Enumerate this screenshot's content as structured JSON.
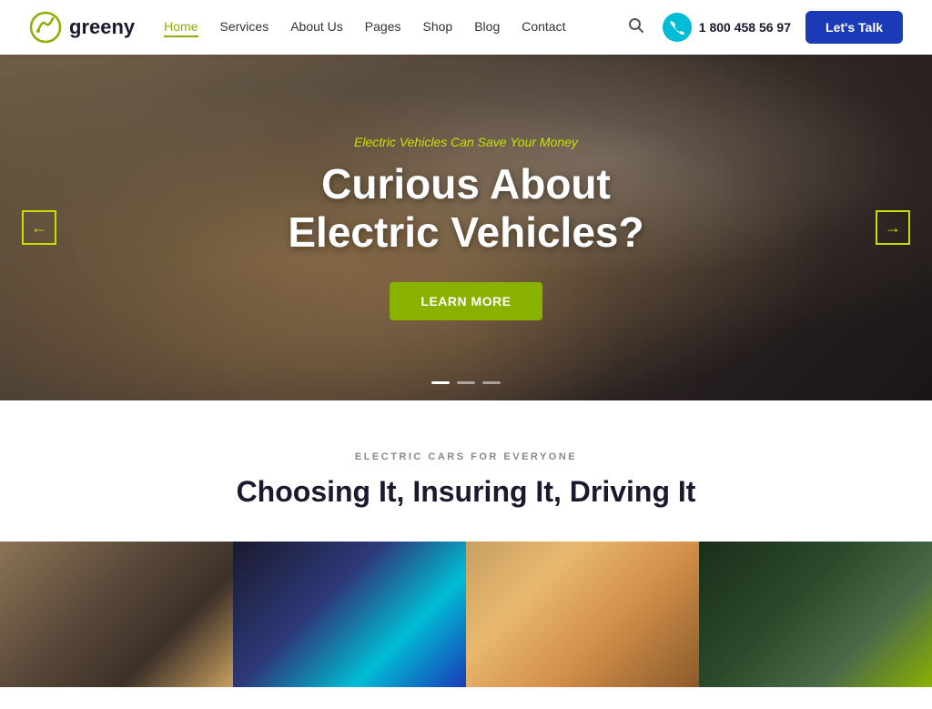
{
  "logo": {
    "text": "greeny",
    "icon_alt": "greeny-logo"
  },
  "nav": {
    "links": [
      {
        "label": "Home",
        "active": true
      },
      {
        "label": "Services",
        "active": false
      },
      {
        "label": "About Us",
        "active": false
      },
      {
        "label": "Pages",
        "active": false
      },
      {
        "label": "Shop",
        "active": false
      },
      {
        "label": "Blog",
        "active": false
      },
      {
        "label": "Contact",
        "active": false
      }
    ]
  },
  "header": {
    "phone_avatar": "☎",
    "phone_number": "1 800 458 56 97",
    "lets_talk_label": "Let's Talk"
  },
  "hero": {
    "subtitle": "Electric Vehicles Can Save Your Money",
    "title_line1": "Curious About",
    "title_line2": "Electric Vehicles?",
    "cta_label": "Learn More",
    "arrow_left": "←",
    "arrow_right": "→",
    "dots": [
      {
        "active": true
      },
      {
        "active": false
      },
      {
        "active": false
      }
    ]
  },
  "section": {
    "eyebrow": "ELECTRIC CARS FOR EVERYONE",
    "title": "Choosing It, Insuring It, Driving It"
  },
  "cards": [
    {
      "alt": "electric car exterior"
    },
    {
      "alt": "electric car charger"
    },
    {
      "alt": "people in car"
    },
    {
      "alt": "green plant"
    }
  ]
}
